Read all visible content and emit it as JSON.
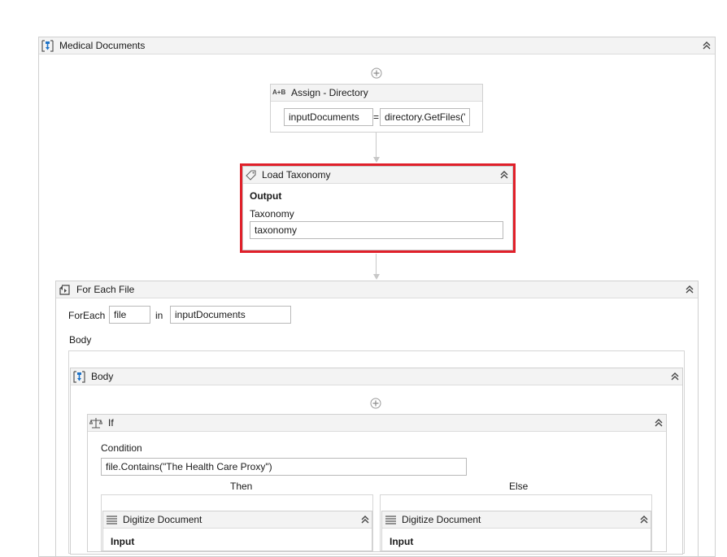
{
  "sequence": {
    "title": "Medical Documents",
    "icon": "sequence-icon"
  },
  "assign": {
    "title": "Assign - Directory",
    "icon": "assign-icon",
    "to_value": "inputDocuments",
    "equals": "=",
    "expr_value": "directory.GetFiles('"
  },
  "load_taxonomy": {
    "title": "Load Taxonomy",
    "icon": "taxonomy-icon",
    "output_label": "Output",
    "taxonomy_label": "Taxonomy",
    "taxonomy_value": "taxonomy",
    "highlight_color": "#e0202a"
  },
  "foreach": {
    "title": "For Each File",
    "icon": "foreach-icon",
    "foreach_label": "ForEach",
    "item_value": "file",
    "in_label": "in",
    "collection_value": "inputDocuments",
    "body_label": "Body"
  },
  "body_sequence": {
    "title": "Body",
    "icon": "sequence-icon"
  },
  "if_activity": {
    "title": "If",
    "icon": "if-icon",
    "condition_label": "Condition",
    "condition_value": "file.Contains(\"The Health Care Proxy\")",
    "then_label": "Then",
    "else_label": "Else"
  },
  "digitize_then": {
    "title": "Digitize Document",
    "icon": "digitize-icon",
    "input_label": "Input"
  },
  "digitize_else": {
    "title": "Digitize Document",
    "icon": "digitize-icon",
    "input_label": "Input"
  }
}
